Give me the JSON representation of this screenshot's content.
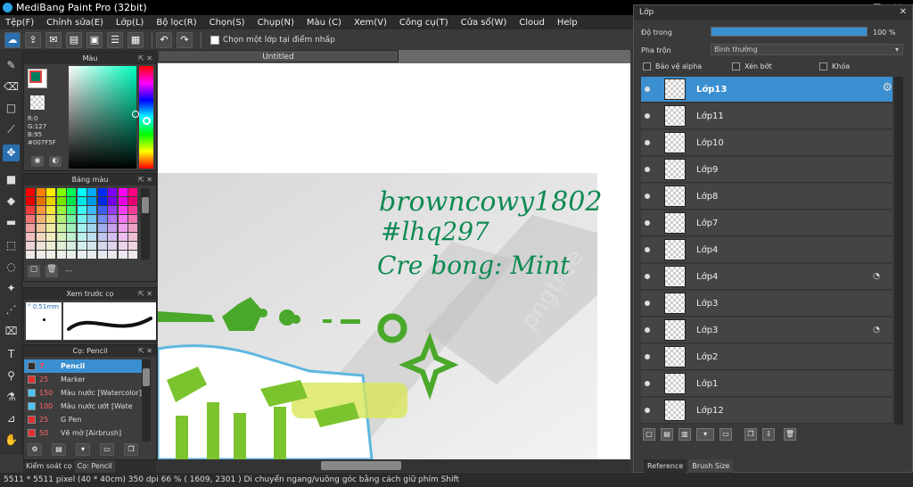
{
  "app": {
    "title": "MediBang Paint Pro (32bit)",
    "window_controls": [
      "–",
      "□",
      "✕"
    ]
  },
  "menu": [
    "Tệp(F)",
    "Chỉnh sửa(E)",
    "Lớp(L)",
    "Bộ lọc(R)",
    "Chọn(S)",
    "Chụp(N)",
    "Màu (C)",
    "Xem(V)",
    "Công cụ(T)",
    "Cửa sổ(W)",
    "Cloud",
    "Help"
  ],
  "toolbar": {
    "snap_label": "Chọn một lớp tại điểm nhấp"
  },
  "color_panel": {
    "title": "Màu",
    "r": "R:0",
    "g": "G:127",
    "b": "B:95",
    "hex": "#007F5F",
    "accent": "#007F5F"
  },
  "palette_panel": {
    "title": "Bảng màu",
    "footer": "---"
  },
  "preview_panel": {
    "title": "Xem trước cọ",
    "size": "0.51mm"
  },
  "brush_panel": {
    "title": "Cọ: Pencil",
    "brushes": [
      {
        "size": "7",
        "name": "Pencil",
        "color": "#2e2e2e"
      },
      {
        "size": "25",
        "name": "Marker",
        "color": "#e03030"
      },
      {
        "size": "150",
        "name": "Màu nước [Watercolor]",
        "color": "#4fc3f7"
      },
      {
        "size": "100",
        "name": "Màu nước ướt [Wate",
        "color": "#4fc3f7"
      },
      {
        "size": "25",
        "name": "G Pen",
        "color": "#e03030"
      },
      {
        "size": "50",
        "name": "Vẽ mờ [Airbrush]",
        "color": "#e03030"
      }
    ],
    "tabs": [
      "Kiểm soát cọ",
      "Cọ: Pencil"
    ]
  },
  "document": {
    "tab": "Untitled",
    "text_lines": [
      "browncowy1802",
      "#lhq297",
      "Cre bong: Mint"
    ],
    "watermark": "pngtree"
  },
  "layer_window": {
    "title": "Lớp",
    "opacity_label": "Độ trong",
    "opacity_value": "100 %",
    "blend_label": "Pha trộn",
    "blend_value": "Bình thường",
    "protect_alpha": "Bảo vệ alpha",
    "clipping": "Xén bớt",
    "lock": "Khóa",
    "layers": [
      "Lớp13",
      "Lớp11",
      "Lớp10",
      "Lớp9",
      "Lớp8",
      "Lớp7",
      "Lớp4",
      "Lớp4",
      "Lớp3",
      "Lớp3",
      "Lớp2",
      "Lớp1",
      "Lớp12"
    ],
    "tabs": [
      "Reference",
      "Brush Size"
    ]
  },
  "status": {
    "text": "5511 * 5511 pixel  (40 * 40cm)  350 dpi  66 %  ( 1609, 2301 )  Di chuyển ngang/vuông góc bằng cách giữ phím Shift"
  },
  "colors": {
    "ink": "#0e8a52",
    "green": "#4aa82a",
    "selected": "#3a8fd0"
  }
}
